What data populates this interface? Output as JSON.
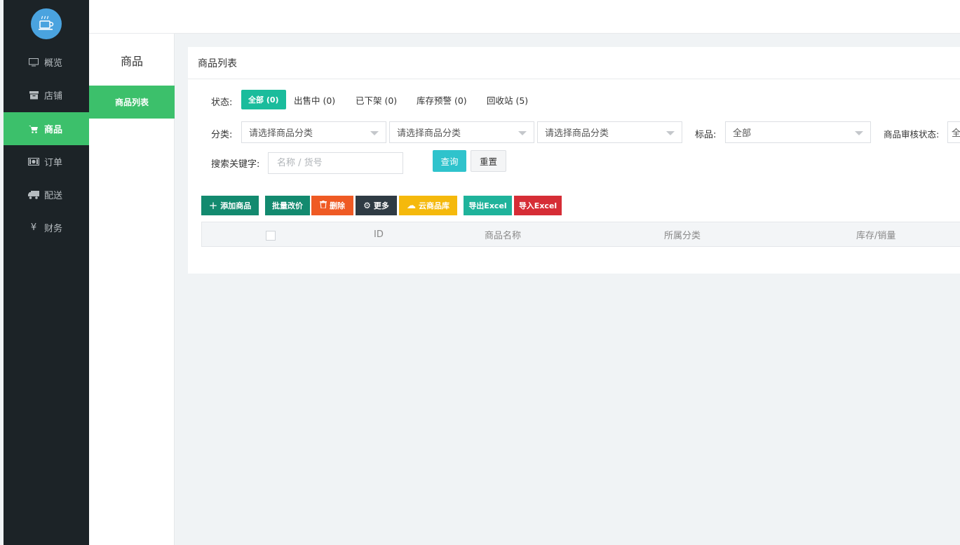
{
  "sidebar": {
    "logo_icon": "coffee-cup-icon",
    "items": [
      {
        "label": "概览",
        "icon": "monitor-icon"
      },
      {
        "label": "店铺",
        "icon": "store-icon"
      },
      {
        "label": "商品",
        "icon": "cart-icon",
        "active": true
      },
      {
        "label": "订单",
        "icon": "money-icon"
      },
      {
        "label": "配送",
        "icon": "truck-icon"
      },
      {
        "label": "财务",
        "icon": "yen-icon"
      }
    ]
  },
  "subnav": {
    "title": "商品",
    "items": [
      {
        "label": "商品列表",
        "active": true
      }
    ]
  },
  "panel": {
    "title": "商品列表",
    "status_label": "状态:",
    "status_tabs": [
      {
        "label": "全部 (0)",
        "active": true
      },
      {
        "label": "出售中 (0)"
      },
      {
        "label": "已下架 (0)"
      },
      {
        "label": "库存预警 (0)"
      },
      {
        "label": "回收站 (5)"
      }
    ],
    "category_label": "分类:",
    "category_selects": [
      "请选择商品分类",
      "请选择商品分类",
      "请选择商品分类"
    ],
    "tag_label": "标品:",
    "tag_select": "全部",
    "audit_label": "商品审核状态:",
    "audit_select": "全部",
    "keyword_label": "搜索关键字:",
    "keyword_placeholder": "名称 / 货号",
    "keyword_value": "",
    "query_button": "查询",
    "reset_button": "重置",
    "toolbar": [
      {
        "label": "添加商品",
        "icon": "plus-icon",
        "glyph": "+",
        "color": "#138a6f"
      },
      {
        "label": "批量改价",
        "color": "#138a6f"
      },
      {
        "label": "删除",
        "icon": "trash-icon",
        "glyph": "🗑",
        "color": "#ef5a24"
      },
      {
        "label": "更多",
        "icon": "gear-icon",
        "glyph": "⚙",
        "color": "#2f3b44"
      },
      {
        "label": "云商品库",
        "icon": "cloud-upload-icon",
        "glyph": "☁",
        "color": "#f5b90c"
      },
      {
        "label": "导出Excel",
        "color": "#1fb39b"
      },
      {
        "label": "导入Excel",
        "color": "#d62d36"
      }
    ],
    "table_headers": [
      "ID",
      "商品名称",
      "所属分类",
      "库存/销量"
    ]
  }
}
